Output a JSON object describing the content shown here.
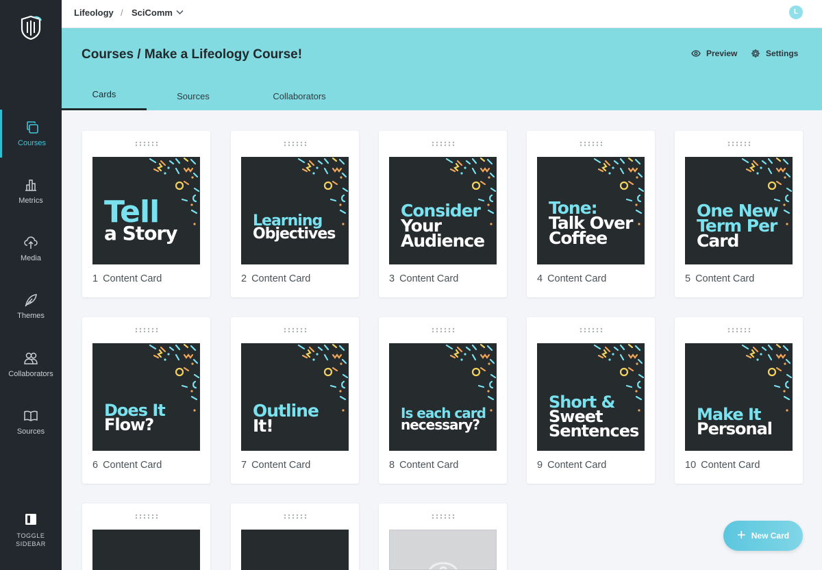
{
  "topbar": {
    "org": "Lifeology",
    "separator": "/",
    "workspace": "SciComm",
    "avatar_initial": "L"
  },
  "sidebar": {
    "items": [
      {
        "label": "Courses",
        "icon": "copy-icon",
        "active": true
      },
      {
        "label": "Metrics",
        "icon": "bar-chart-icon",
        "active": false
      },
      {
        "label": "Media",
        "icon": "cloud-upload-icon",
        "active": false
      },
      {
        "label": "Themes",
        "icon": "feather-icon",
        "active": false
      },
      {
        "label": "Collaborators",
        "icon": "users-icon",
        "active": false
      },
      {
        "label": "Sources",
        "icon": "book-icon",
        "active": false
      }
    ],
    "toggle_line1": "TOGGLE",
    "toggle_line2": "SIDEBAR"
  },
  "header": {
    "title": "Courses / Make a Lifeology Course!",
    "preview_label": "Preview",
    "settings_label": "Settings",
    "tabs": [
      {
        "label": "Cards",
        "active": true
      },
      {
        "label": "Sources",
        "active": false
      },
      {
        "label": "Collaborators",
        "active": false
      }
    ]
  },
  "cards": [
    {
      "number": "1",
      "type": "Content Card",
      "lines": [
        "Tell",
        "a Story"
      ]
    },
    {
      "number": "2",
      "type": "Content Card",
      "lines": [
        "Learning",
        "Objectives"
      ]
    },
    {
      "number": "3",
      "type": "Content Card",
      "lines": [
        "Consider",
        "Your",
        "Audience"
      ]
    },
    {
      "number": "4",
      "type": "Content Card",
      "lines": [
        "Tone:",
        "Talk Over",
        "Coffee"
      ]
    },
    {
      "number": "5",
      "type": "Content Card",
      "lines": [
        "One New",
        "Term Per",
        "Card"
      ]
    },
    {
      "number": "6",
      "type": "Content Card",
      "lines": [
        "Does It",
        "Flow?"
      ]
    },
    {
      "number": "7",
      "type": "Content Card",
      "lines": [
        "Outline",
        "It!"
      ]
    },
    {
      "number": "8",
      "type": "Content Card",
      "lines": [
        "Is each card",
        "necessary?"
      ]
    },
    {
      "number": "9",
      "type": "Content Card",
      "lines": [
        "Short &",
        "Sweet",
        "Sentences"
      ]
    },
    {
      "number": "10",
      "type": "Content Card",
      "lines": [
        "Make It",
        "Personal"
      ]
    }
  ],
  "new_card_label": "New Card",
  "colors": {
    "sidebar_bg": "#22282d",
    "accent": "#43c6d9",
    "header_bg": "#83dbe2",
    "card_thumb_bg": "#262b2e",
    "title_cyan": "#7ae2ef"
  }
}
